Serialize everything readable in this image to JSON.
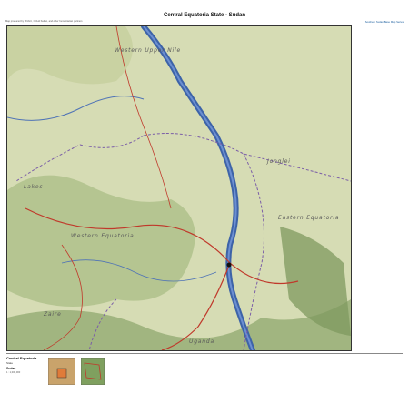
{
  "title": "Central Equatoria State - Sudan",
  "header_note_left": "Map produced by UNJLC, OCHA Sudan, and other humanitarian partners",
  "header_note_right": "Southern Sudan Base Map Series",
  "map": {
    "labels": [
      "Western Upper Nile",
      "Jonglei",
      "Lakes",
      "Western Equatoria",
      "Eastern Equatoria",
      "Zaire",
      "Uganda"
    ],
    "colors": {
      "water": "#3d63a8",
      "terrain": "#d6dcb4",
      "forest": "#8aa46a",
      "roads": "#c0392b",
      "boundary": "#7b5ea7"
    }
  },
  "legend": {
    "title": "Central Equatoria",
    "subtitle": "State",
    "place": "Sudan",
    "scale": "1 : 1,000,000"
  }
}
